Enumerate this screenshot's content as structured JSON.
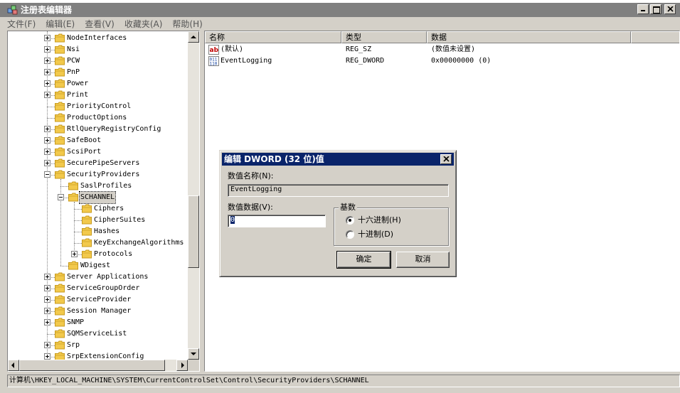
{
  "window": {
    "title": "注册表编辑器",
    "menu": [
      "文件(F)",
      "编辑(E)",
      "查看(V)",
      "收藏夹(A)",
      "帮助(H)"
    ]
  },
  "tree": {
    "items": [
      {
        "label": "NodeInterfaces",
        "level": 0,
        "expander": "plus"
      },
      {
        "label": "Nsi",
        "level": 0,
        "expander": "plus"
      },
      {
        "label": "PCW",
        "level": 0,
        "expander": "plus"
      },
      {
        "label": "PnP",
        "level": 0,
        "expander": "plus"
      },
      {
        "label": "Power",
        "level": 0,
        "expander": "plus"
      },
      {
        "label": "Print",
        "level": 0,
        "expander": "plus"
      },
      {
        "label": "PriorityControl",
        "level": 0,
        "expander": "none"
      },
      {
        "label": "ProductOptions",
        "level": 0,
        "expander": "none"
      },
      {
        "label": "RtlQueryRegistryConfig",
        "level": 0,
        "expander": "plus"
      },
      {
        "label": "SafeBoot",
        "level": 0,
        "expander": "plus"
      },
      {
        "label": "ScsiPort",
        "level": 0,
        "expander": "plus"
      },
      {
        "label": "SecurePipeServers",
        "level": 0,
        "expander": "plus"
      },
      {
        "label": "SecurityProviders",
        "level": 0,
        "expander": "minus"
      },
      {
        "label": "SaslProfiles",
        "level": 1,
        "expander": "none"
      },
      {
        "label": "SCHANNEL",
        "level": 1,
        "expander": "minus",
        "selected": true
      },
      {
        "label": "Ciphers",
        "level": 2,
        "expander": "none"
      },
      {
        "label": "CipherSuites",
        "level": 2,
        "expander": "none"
      },
      {
        "label": "Hashes",
        "level": 2,
        "expander": "none"
      },
      {
        "label": "KeyExchangeAlgorithms",
        "level": 2,
        "expander": "none"
      },
      {
        "label": "Protocols",
        "level": 2,
        "expander": "plus"
      },
      {
        "label": "WDigest",
        "level": 1,
        "expander": "none"
      },
      {
        "label": "Server Applications",
        "level": 0,
        "expander": "plus"
      },
      {
        "label": "ServiceGroupOrder",
        "level": 0,
        "expander": "plus"
      },
      {
        "label": "ServiceProvider",
        "level": 0,
        "expander": "plus"
      },
      {
        "label": "Session Manager",
        "level": 0,
        "expander": "plus"
      },
      {
        "label": "SNMP",
        "level": 0,
        "expander": "plus"
      },
      {
        "label": "SQMServiceList",
        "level": 0,
        "expander": "none"
      },
      {
        "label": "Srp",
        "level": 0,
        "expander": "plus"
      },
      {
        "label": "SrpExtensionConfig",
        "level": 0,
        "expander": "plus"
      }
    ]
  },
  "list": {
    "columns": [
      "名称",
      "类型",
      "数据"
    ],
    "rows": [
      {
        "name": "(默认)",
        "type": "REG_SZ",
        "data": "(数值未设置)",
        "icon": "string-value-icon"
      },
      {
        "name": "EventLogging",
        "type": "REG_DWORD",
        "data": "0x00000000 (0)",
        "icon": "binary-value-icon"
      }
    ]
  },
  "status": {
    "path": "计算机\\HKEY_LOCAL_MACHINE\\SYSTEM\\CurrentControlSet\\Control\\SecurityProviders\\SCHANNEL"
  },
  "dialog": {
    "title": "编辑 DWORD (32 位)值",
    "name_label": "数值名称(N):",
    "name_value": "EventLogging",
    "data_label": "数值数据(V):",
    "data_value": "0",
    "base_label": "基数",
    "hex_label": "十六进制(H)",
    "dec_label": "十进制(D)",
    "base_selected": "hex",
    "ok_label": "确定",
    "cancel_label": "取消"
  },
  "colors": {
    "folder": "#f2c94c",
    "folder_dark": "#c89b1e",
    "dialog_title": "#0a246a"
  }
}
